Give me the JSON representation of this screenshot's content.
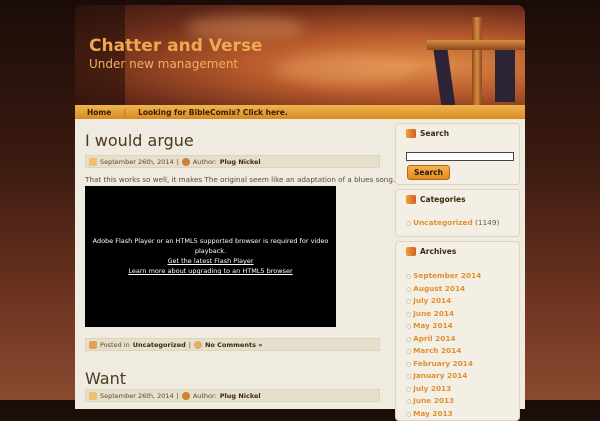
{
  "site": {
    "title": "Chatter and Verse",
    "tagline": "Under new management"
  },
  "nav": [
    {
      "label": "Home"
    },
    {
      "label": "Looking for BibleComix? Click here."
    }
  ],
  "posts": [
    {
      "title": "I would argue",
      "date": "September 26th, 2014",
      "author_label": "Author:",
      "author": "Plug Nickel",
      "excerpt": "That this works so well, it makes The original seem like an adaptation of a blues song.",
      "video": {
        "message": "Adobe Flash Player or an HTML5 supported browser is required for video playback.",
        "link1": "Get the latest Flash Player",
        "link2": "Learn more about upgrading to an HTML5 browser"
      },
      "posted_in_label": "Posted in",
      "category": "Uncategorized",
      "comments": "No Comments »"
    },
    {
      "title": "Want",
      "date": "September 26th, 2014",
      "author_label": "Author:",
      "author": "Plug Nickel"
    }
  ],
  "sidebar": {
    "search": {
      "title": "Search",
      "button": "Search",
      "value": ""
    },
    "categories": {
      "title": "Categories",
      "items": [
        {
          "label": "Uncategorized",
          "count": "(1149)"
        }
      ]
    },
    "archives": {
      "title": "Archives",
      "items": [
        "September 2014",
        "August 2014",
        "July 2014",
        "June 2014",
        "May 2014",
        "April 2014",
        "March 2014",
        "February 2014",
        "January 2014",
        "July 2013",
        "June 2013",
        "May 2013"
      ]
    }
  }
}
